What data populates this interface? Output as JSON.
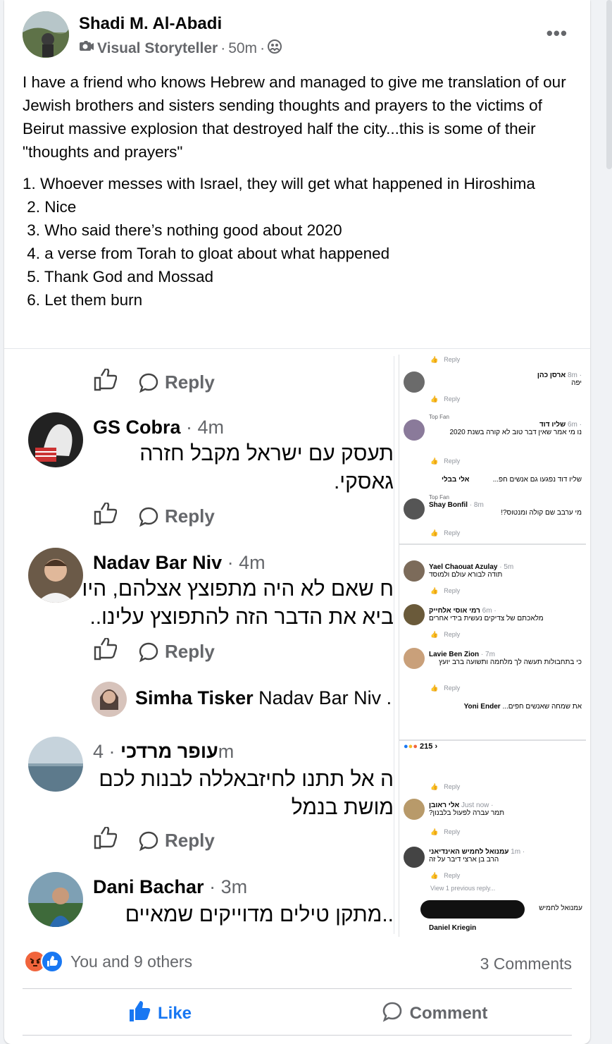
{
  "post": {
    "author": "Shadi M. Al-Abadi",
    "subtitle": "Visual Storyteller",
    "time": "50m",
    "text_intro": "I have a friend who knows Hebrew and managed to give me translation of our Jewish brothers and sisters sending thoughts and prayers to the victims of Beirut massive explosion that destroyed half the city...this is some of their \"thoughts and prayers\"",
    "list": [
      "1. Whoever messes with Israel, they will get what happened in Hiroshima",
      " 2. Nice",
      " 3. Who said there’s nothing good about 2020",
      " 4. a verse from Torah to gloat about what happened",
      " 5. Thank God and Mossad",
      " 6. Let them burn"
    ]
  },
  "screenshot_left": {
    "reply_label": "Reply",
    "comments": [
      {
        "name": "GS Cobra",
        "time": "· 4m",
        "lines": [
          "תעסק עם ישראל מקבל חזרה",
          "גאסקי."
        ]
      },
      {
        "name": "Nadav Bar Niv",
        "time": "· 4m",
        "lines": [
          "ח שאם לא היה מתפוצץ אצלהם, היו",
          "ביא את הדבר הזה להתפוצץ עלינו.."
        ]
      },
      {
        "name": "עופר מרדכי",
        "time": "· 4m",
        "lines": [
          "ה אל תתנו לחיזבאללה לבנות לכם",
          "מושת בנמל"
        ]
      },
      {
        "name": "Dani Bachar",
        "time": "· 3m",
        "lines": [
          "..מתקן טילים מדוייקים שמאיים"
        ]
      }
    ],
    "nested_reply": {
      "name": "Simha Tisker",
      "text": "Nadav Bar Niv ."
    }
  },
  "screenshot_right": {
    "top_fan": "Top Fan",
    "reply": "Reply",
    "react_count": "215",
    "view_previous": "View 1 previous reply...",
    "comments": [
      {
        "name": "ארסן כהן",
        "time": "· 8m",
        "text": "יפה"
      },
      {
        "name": "שליו דוד",
        "time": "· 6m",
        "text": "נו מי אמר שאין דבר טוב לא קורה בשנת 2020"
      },
      {
        "name": "אלי בבלי",
        "time": "",
        "text": "שליו דוד נפגעו גם אנשים חפ..."
      },
      {
        "name": "Shay Bonfil",
        "time": "· 8m",
        "text": "מי ערבב שם קולה ומנטוס?!"
      },
      {
        "name": "Yael Chaouat Azulay",
        "time": "· 5m",
        "text": "תודה לבורא עולם ולמוסד"
      },
      {
        "name": "רמי אוסי אלחייק",
        "time": "· 6m",
        "text": "מלאכתם של צדיקים נעשית בידי אחרים"
      },
      {
        "name": "Lavie Ben Zion",
        "time": "· 7m",
        "text": "כי בתחבולות תעשה לך מלחמה ותשועה ברב יועץ"
      },
      {
        "name": "Yoni Ender",
        "time": "",
        "text": "את שמחה שאנשים חפים..."
      },
      {
        "name": "אלי ראובן",
        "time": "· Just now",
        "text": "תמר עברה לפעול בלבנון?"
      },
      {
        "name": "עמנואל לחמיש האינדיאני",
        "time": "· 1m",
        "text": "הרב בן ארצי דיבר על זה"
      },
      {
        "name": "Daniel Kriegin",
        "time": "",
        "text": ""
      }
    ],
    "comment_prefix": "עמנואל לחמיש"
  },
  "footer": {
    "reactions_text": "You and 9 others",
    "comments_count": "3 Comments",
    "like_label": "Like",
    "comment_label": "Comment"
  },
  "colors": {
    "brand_blue": "#1877f2",
    "secondary_text": "#65676b",
    "angry_orange": "#f0643c"
  }
}
